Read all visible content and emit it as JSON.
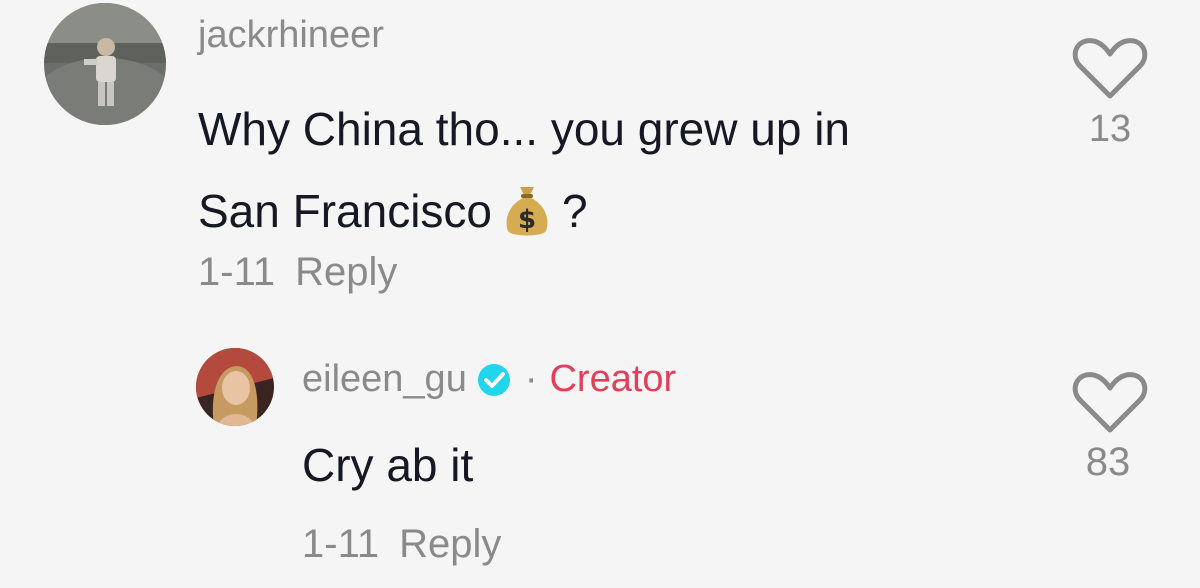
{
  "comments": [
    {
      "username": "jackrhineer",
      "text_line1": "Why China tho... you grew up in",
      "text_line2_before": "San Francisco",
      "emoji": "money-bag",
      "text_line2_after": "?",
      "date": "1-11",
      "reply_label": "Reply",
      "like_count": "13"
    },
    {
      "username": "eileen_gu",
      "verified": true,
      "separator": "·",
      "role_badge": "Creator",
      "text": "Cry ab it",
      "date": "1-11",
      "reply_label": "Reply",
      "like_count": "83"
    }
  ],
  "colors": {
    "background": "#f5f5f5",
    "text": "#161823",
    "muted": "#8a8a8a",
    "creator": "#e2405a",
    "verified": "#20d5ec"
  }
}
